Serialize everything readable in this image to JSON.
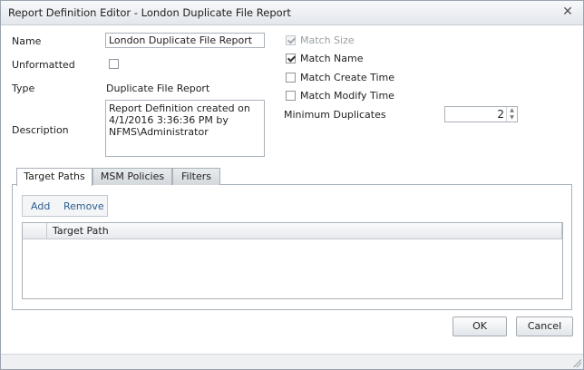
{
  "window": {
    "title": "Report Definition Editor - London Duplicate File Report",
    "close_glyph": "✕"
  },
  "form": {
    "name_label": "Name",
    "name_value": "London Duplicate File Report",
    "unformatted_label": "Unformatted",
    "unformatted_checked": false,
    "type_label": "Type",
    "type_value": "Duplicate File Report",
    "description_label": "Description",
    "description_value": "Report Definition created on 4/1/2016 3:36:36 PM by NFMS\\Administrator"
  },
  "options": {
    "match_size_label": "Match Size",
    "match_size_checked": true,
    "match_size_enabled": false,
    "match_name_label": "Match Name",
    "match_name_checked": true,
    "match_create_label": "Match Create Time",
    "match_create_checked": false,
    "match_modify_label": "Match Modify Time",
    "match_modify_checked": false,
    "min_duplicates_label": "Minimum Duplicates",
    "min_duplicates_value": "2",
    "spin_up_glyph": "▲",
    "spin_down_glyph": "▼"
  },
  "tabs": [
    {
      "label": "Target Paths",
      "active": true
    },
    {
      "label": "MSM Policies",
      "active": false
    },
    {
      "label": "Filters",
      "active": false
    }
  ],
  "toolbar": {
    "add_label": "Add",
    "remove_label": "Remove"
  },
  "grid": {
    "columns": [
      "Target Path"
    ],
    "rows": []
  },
  "buttons": {
    "ok_label": "OK",
    "cancel_label": "Cancel"
  }
}
